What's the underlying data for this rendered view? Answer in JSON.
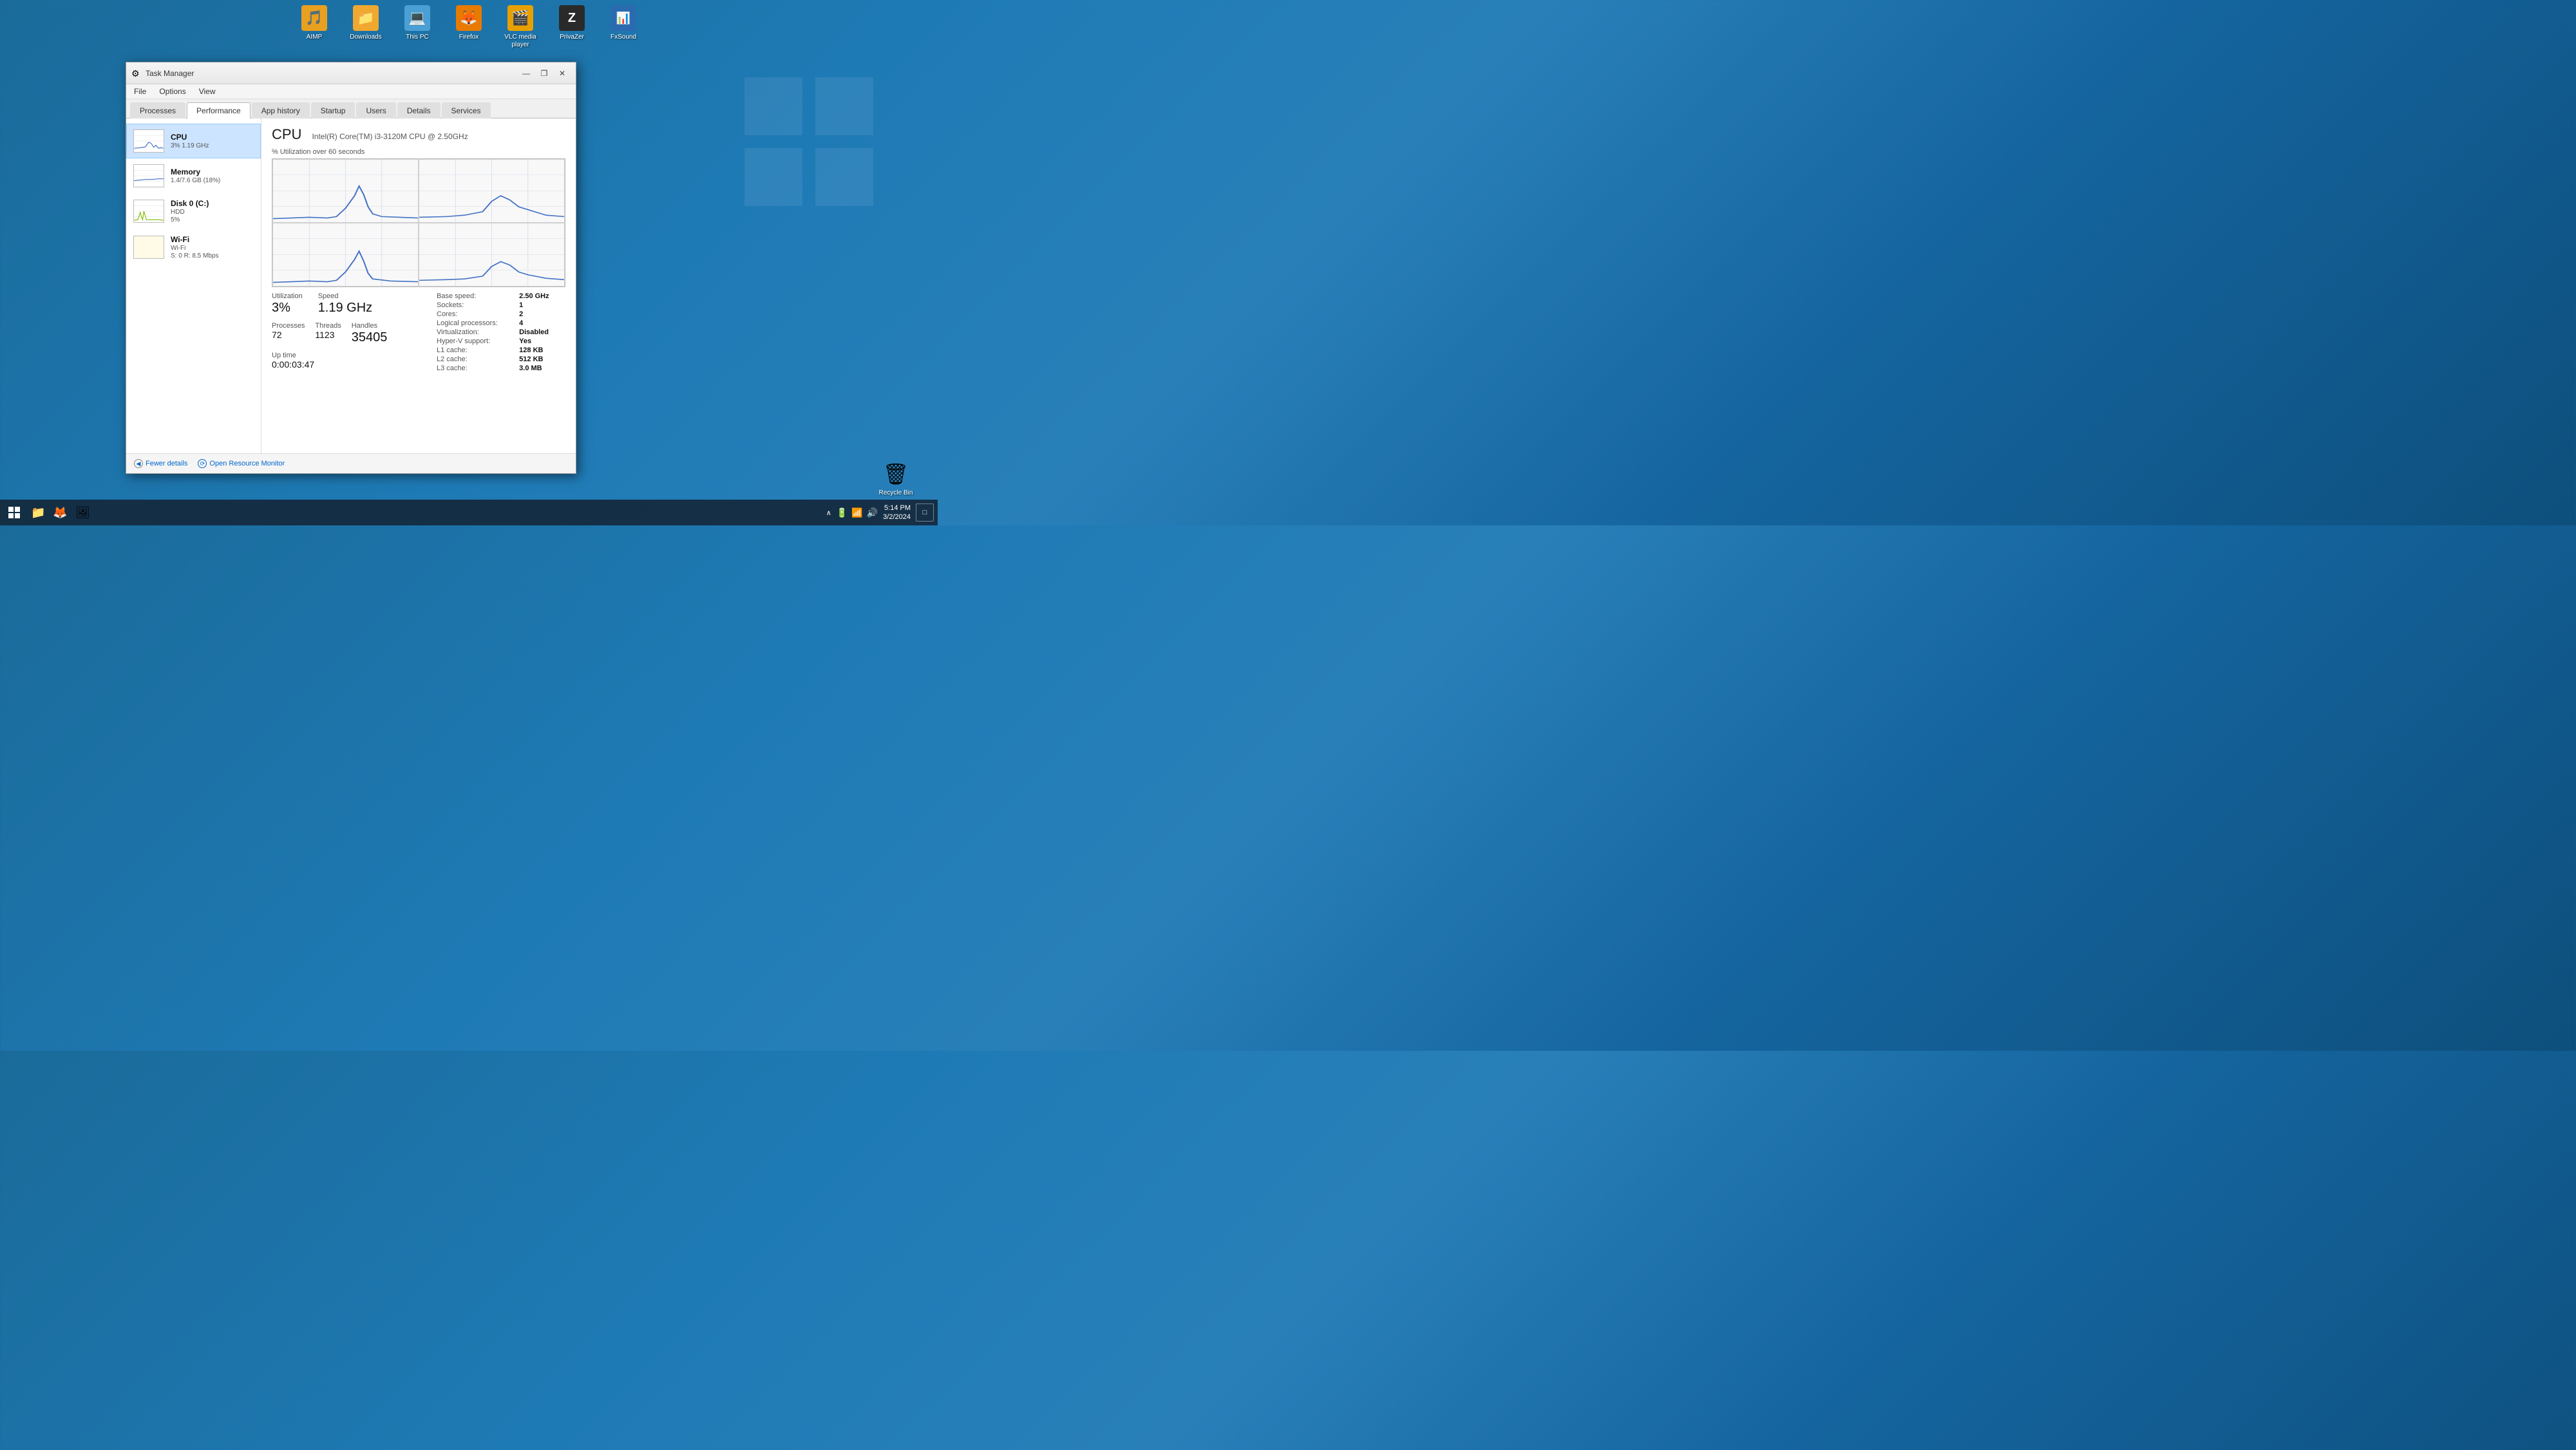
{
  "desktop": {
    "icons": [
      {
        "id": "aimp",
        "label": "AIMP",
        "symbol": "🎵",
        "color": "#e8a020"
      },
      {
        "id": "downloads",
        "label": "Downloads",
        "symbol": "📁",
        "color": "#f0a830"
      },
      {
        "id": "this-pc",
        "label": "This PC",
        "symbol": "💻",
        "color": "#4a9fd4"
      },
      {
        "id": "firefox",
        "label": "Firefox",
        "symbol": "🦊",
        "color": "#e87a00"
      },
      {
        "id": "vlc",
        "label": "VLC media player",
        "symbol": "🎬",
        "color": "#e8a000"
      },
      {
        "id": "privazer",
        "label": "PrivaZer",
        "symbol": "Z",
        "color": "#333"
      },
      {
        "id": "fxsound",
        "label": "FxSound",
        "symbol": "📊",
        "color": "#2a6bb0"
      }
    ],
    "recycle_bin": {
      "label": "Recycle Bin",
      "symbol": "🗑"
    }
  },
  "taskbar": {
    "start_label": "Start",
    "clock": {
      "time": "5:14 PM",
      "date": "3/2/2024"
    },
    "app_buttons": [
      "📁",
      "🦊"
    ]
  },
  "task_manager": {
    "title": "Task Manager",
    "menu": {
      "file": "File",
      "options": "Options",
      "view": "View"
    },
    "tabs": [
      {
        "id": "processes",
        "label": "Processes",
        "active": false
      },
      {
        "id": "performance",
        "label": "Performance",
        "active": true
      },
      {
        "id": "app-history",
        "label": "App history",
        "active": false
      },
      {
        "id": "startup",
        "label": "Startup",
        "active": false
      },
      {
        "id": "users",
        "label": "Users",
        "active": false
      },
      {
        "id": "details",
        "label": "Details",
        "active": false
      },
      {
        "id": "services",
        "label": "Services",
        "active": false
      }
    ],
    "sidebar": {
      "items": [
        {
          "id": "cpu",
          "name": "CPU",
          "detail": "3%  1.19 GHz",
          "active": true
        },
        {
          "id": "memory",
          "name": "Memory",
          "detail": "1.4/7.6 GB (18%)"
        },
        {
          "id": "disk",
          "name": "Disk 0 (C:)",
          "detail_line1": "HDD",
          "detail_line2": "5%"
        },
        {
          "id": "wifi",
          "name": "Wi-Fi",
          "detail_line1": "Wi-Fi",
          "detail_line2": "S: 0 R: 8.5 Mbps"
        }
      ]
    },
    "cpu_panel": {
      "title": "CPU",
      "subtitle": "Intel(R) Core(TM) i3-3120M CPU @ 2.50GHz",
      "chart_label": "% Utilization over 60 seconds",
      "chart_max": "100%",
      "stats": {
        "utilization_label": "Utilization",
        "utilization_value": "3%",
        "speed_label": "Speed",
        "speed_value": "1.19 GHz",
        "processes_label": "Processes",
        "processes_value": "72",
        "threads_label": "Threads",
        "threads_value": "1123",
        "handles_label": "Handles",
        "handles_value": "35405",
        "uptime_label": "Up time",
        "uptime_value": "0:00:03:47"
      },
      "info": {
        "base_speed_label": "Base speed:",
        "base_speed_value": "2.50 GHz",
        "sockets_label": "Sockets:",
        "sockets_value": "1",
        "cores_label": "Cores:",
        "cores_value": "2",
        "logical_processors_label": "Logical processors:",
        "logical_processors_value": "4",
        "virtualization_label": "Virtualization:",
        "virtualization_value": "Disabled",
        "hyperv_label": "Hyper-V support:",
        "hyperv_value": "Yes",
        "l1_label": "L1 cache:",
        "l1_value": "128 KB",
        "l2_label": "L2 cache:",
        "l2_value": "512 KB",
        "l3_label": "L3 cache:",
        "l3_value": "3.0 MB"
      }
    },
    "footer": {
      "fewer_details": "Fewer details",
      "open_resource_monitor": "Open Resource Monitor"
    }
  }
}
